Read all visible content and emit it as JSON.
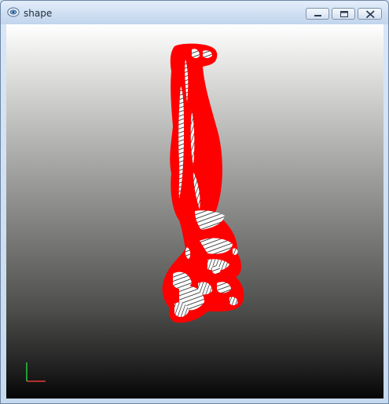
{
  "window": {
    "title": "shape",
    "icon": "viewer-app-icon"
  },
  "controls": {
    "minimize": "minimize-icon",
    "maximize": "maximize-icon",
    "close": "close-icon"
  },
  "viewport": {
    "background_top": "#ffffff",
    "background_bottom": "#050505",
    "shape_fill": "#ff0000",
    "wireframe_color": "#000000",
    "axis_x_color": "#e83a3a",
    "axis_y_color": "#27c93f"
  }
}
